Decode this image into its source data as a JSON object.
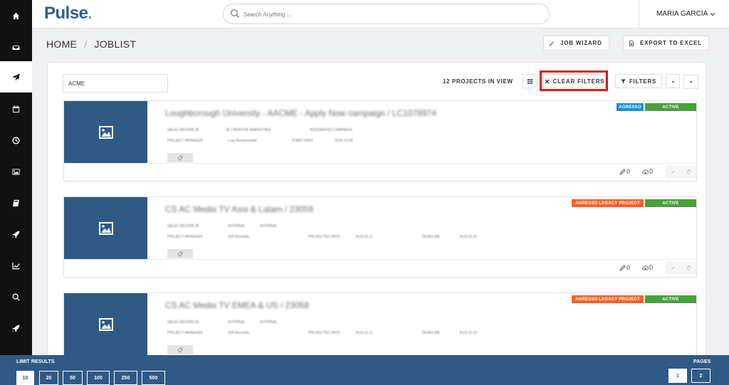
{
  "app": {
    "logo": "Pulse"
  },
  "colors": {
    "brand": "#2f5a85",
    "highlight": "#e0171b",
    "agresso": "#1b8fd2",
    "agresso_legacy": "#f4622a",
    "active": "#4aa03c"
  },
  "sidebar": {
    "items": [
      {
        "name": "home-icon",
        "active": false
      },
      {
        "name": "inbox-icon",
        "active": false
      },
      {
        "name": "send-icon",
        "active": true
      },
      {
        "name": "calendar-icon",
        "active": false
      },
      {
        "name": "clock-icon",
        "active": false
      },
      {
        "name": "image-icon",
        "active": false
      },
      {
        "name": "book-icon",
        "active": false
      },
      {
        "name": "rocket-icon",
        "active": false
      },
      {
        "name": "chart-icon",
        "active": false
      },
      {
        "name": "search-icon",
        "active": false
      },
      {
        "name": "rocket-icon",
        "active": false
      }
    ]
  },
  "search": {
    "placeholder": "Search Anything ..."
  },
  "user": {
    "name": "MARIA GARCIA"
  },
  "breadcrumb": {
    "home": "HOME",
    "separator": "/",
    "current": "JOBLIST"
  },
  "header_actions": {
    "job_wizard": "JOB WIZARD",
    "export": "EXPORT TO EXCEL"
  },
  "toolbar": {
    "filter_value": "ACME",
    "project_count": "12 PROJECTS IN VIEW",
    "clear_filters": "CLEAR FILTERS",
    "filters": "FILTERS"
  },
  "projects": [
    {
      "title": "Loughborough University - AACME - Apply Now campaign / LC1078974",
      "meta1": [
        "SALES REGION 3E",
        "3E CREATIVE MARKETING",
        "INTEGRATED CAMPAIGN"
      ],
      "meta2": [
        "PROJECT MANAGER",
        "Lucy Romanowski",
        "START DATE",
        "2019-10-08"
      ],
      "badges": [
        "AGRESSO",
        "ACTIVE"
      ],
      "edits": "0",
      "uploads": "0"
    },
    {
      "title": "CS AC Media TV Asia & Latam / 23059",
      "meta1": [
        "SALES REGION 3E",
        "INTERNAL",
        "INTERNAL"
      ],
      "meta2": [
        "PROJECT MANAGER",
        "Jeff Reynolds",
        "PROJECTED DATE",
        "2019-11-11",
        "DEADLINE",
        "2019-12-31"
      ],
      "badges": [
        "AGRESSO LEGACY PROJECT",
        "ACTIVE"
      ],
      "edits": "0",
      "uploads": "0"
    },
    {
      "title": "CS AC Media TV EMEA & US / 23058",
      "meta1": [
        "SALES REGION 3E",
        "INTERNAL",
        "INTERNAL"
      ],
      "meta2": [
        "PROJECT MANAGER",
        "Jeff Reynolds",
        "PROJECTED DATE",
        "2019-11-11",
        "DEADLINE",
        "2019-12-31"
      ],
      "badges": [
        "AGRESSO LEGACY PROJECT",
        "ACTIVE"
      ],
      "edits": "0",
      "uploads": "0"
    }
  ],
  "footer": {
    "limit_label": "LIMIT RESULTS",
    "limits": [
      "10",
      "20",
      "50",
      "100",
      "250",
      "500"
    ],
    "selected_limit": "10",
    "pages_label": "PAGES",
    "pages": [
      "1",
      "2"
    ],
    "current_page": "1"
  }
}
